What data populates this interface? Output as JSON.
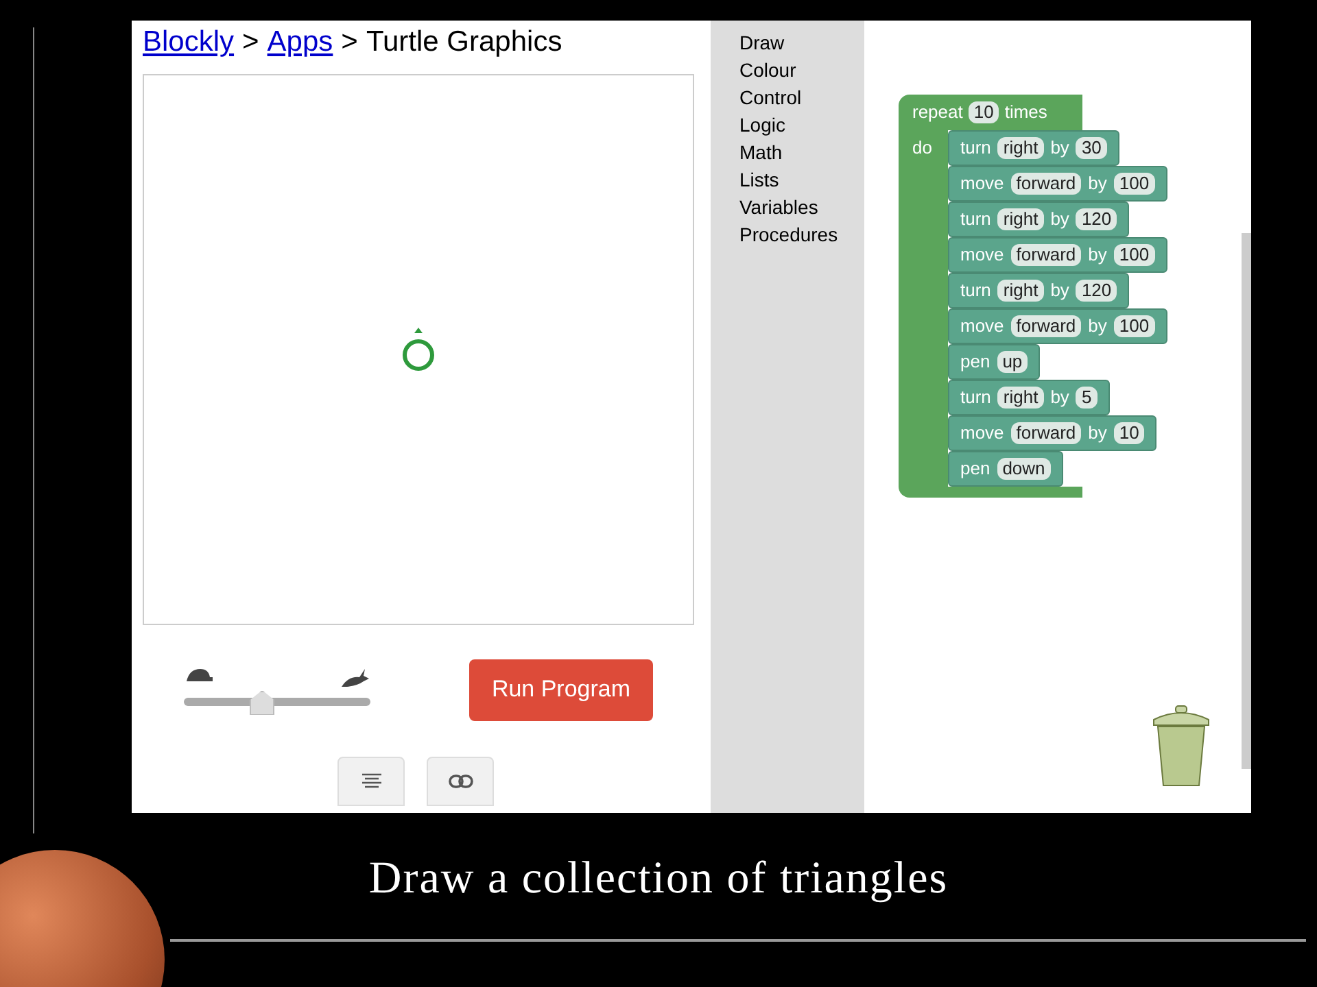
{
  "breadcrumb": [
    {
      "text": "Blockly",
      "kind": "link"
    },
    {
      "text": ">",
      "kind": "sep"
    },
    {
      "text": "Apps",
      "kind": "link"
    },
    {
      "text": ">",
      "kind": "sep"
    },
    {
      "text": "Turtle Graphics",
      "kind": "current"
    }
  ],
  "speed_slider": {
    "level": 0.42
  },
  "run_button": "Run Program",
  "toolbox": [
    "Draw",
    "Colour",
    "Control",
    "Logic",
    "Math",
    "Lists",
    "Variables",
    "Procedures"
  ],
  "repeat_block": {
    "header": [
      {
        "kind": "text",
        "text": "repeat"
      },
      {
        "kind": "field",
        "text": "10"
      },
      {
        "kind": "text",
        "text": "times"
      }
    ],
    "do_label": "do",
    "statements": [
      {
        "tokens": [
          {
            "kind": "text",
            "text": "turn"
          },
          {
            "kind": "field",
            "text": "right"
          },
          {
            "kind": "text",
            "text": "by"
          },
          {
            "kind": "field",
            "text": "30"
          }
        ]
      },
      {
        "tokens": [
          {
            "kind": "text",
            "text": "move"
          },
          {
            "kind": "field",
            "text": "forward"
          },
          {
            "kind": "text",
            "text": "by"
          },
          {
            "kind": "field",
            "text": "100"
          }
        ]
      },
      {
        "tokens": [
          {
            "kind": "text",
            "text": "turn"
          },
          {
            "kind": "field",
            "text": "right"
          },
          {
            "kind": "text",
            "text": "by"
          },
          {
            "kind": "field",
            "text": "120"
          }
        ]
      },
      {
        "tokens": [
          {
            "kind": "text",
            "text": "move"
          },
          {
            "kind": "field",
            "text": "forward"
          },
          {
            "kind": "text",
            "text": "by"
          },
          {
            "kind": "field",
            "text": "100"
          }
        ]
      },
      {
        "tokens": [
          {
            "kind": "text",
            "text": "turn"
          },
          {
            "kind": "field",
            "text": "right"
          },
          {
            "kind": "text",
            "text": "by"
          },
          {
            "kind": "field",
            "text": "120"
          }
        ]
      },
      {
        "tokens": [
          {
            "kind": "text",
            "text": "move"
          },
          {
            "kind": "field",
            "text": "forward"
          },
          {
            "kind": "text",
            "text": "by"
          },
          {
            "kind": "field",
            "text": "100"
          }
        ]
      },
      {
        "tokens": [
          {
            "kind": "text",
            "text": "pen"
          },
          {
            "kind": "field",
            "text": "up"
          }
        ]
      },
      {
        "tokens": [
          {
            "kind": "text",
            "text": "turn"
          },
          {
            "kind": "field",
            "text": "right"
          },
          {
            "kind": "text",
            "text": "by"
          },
          {
            "kind": "field",
            "text": "5"
          }
        ]
      },
      {
        "tokens": [
          {
            "kind": "text",
            "text": "move"
          },
          {
            "kind": "field",
            "text": "forward"
          },
          {
            "kind": "text",
            "text": "by"
          },
          {
            "kind": "field",
            "text": "10"
          }
        ]
      },
      {
        "tokens": [
          {
            "kind": "text",
            "text": "pen"
          },
          {
            "kind": "field",
            "text": "down"
          }
        ]
      }
    ]
  },
  "slide_title": "Draw a collection of triangles"
}
